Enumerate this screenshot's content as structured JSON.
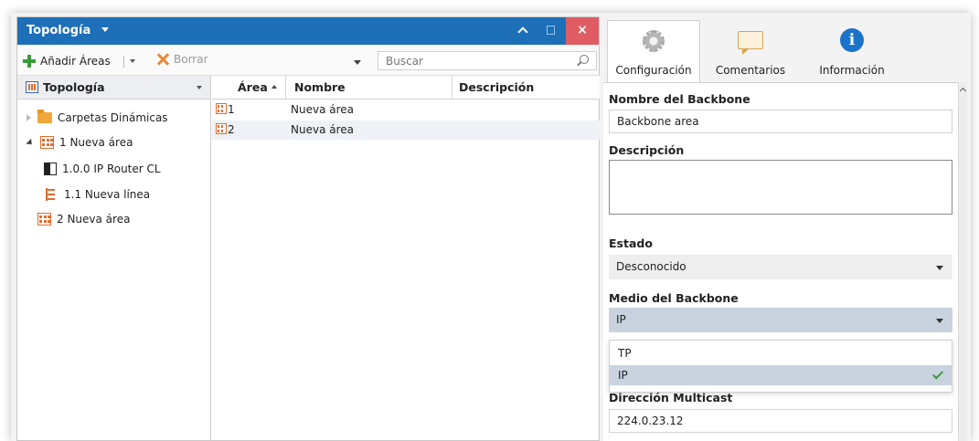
{
  "window": {
    "title": "Topología",
    "buttons": {
      "close": "×"
    }
  },
  "toolbar": {
    "add_label": "Añadir Áreas",
    "delete_label": "Borrar",
    "search_placeholder": "Buscar"
  },
  "tree": {
    "header": "Topología",
    "items": [
      {
        "label": "Carpetas Dinámicas",
        "icon": "folder-icon"
      },
      {
        "label": "1 Nueva área",
        "icon": "area-icon"
      },
      {
        "label": "1.0.0 IP Router CL",
        "icon": "router-icon"
      },
      {
        "label": "1.1 Nueva línea",
        "icon": "line-icon"
      },
      {
        "label": "2 Nueva área",
        "icon": "area-icon"
      }
    ]
  },
  "grid": {
    "columns": [
      "Área",
      "Nombre",
      "Descripción"
    ],
    "rows": [
      {
        "area": "1",
        "nombre": "Nueva área",
        "descripcion": ""
      },
      {
        "area": "2",
        "nombre": "Nueva área",
        "descripcion": ""
      }
    ]
  },
  "panel": {
    "tabs": [
      {
        "label": "Configuración",
        "icon": "gear-icon"
      },
      {
        "label": "Comentarios",
        "icon": "comment-icon"
      },
      {
        "label": "Información",
        "icon": "info-icon",
        "glyph": "i"
      }
    ],
    "fields": {
      "backbone_name_label": "Nombre del Backbone",
      "backbone_name_value": "Backbone area",
      "description_label": "Descripción",
      "description_value": "",
      "state_label": "Estado",
      "state_value": "Desconocido",
      "medium_label": "Medio del Backbone",
      "medium_value": "IP",
      "medium_options": [
        "TP",
        "IP"
      ],
      "multicast_label": "Dirección Multicast",
      "multicast_value": "224.0.23.12"
    }
  },
  "colors": {
    "titlebar": "#1d6fb8",
    "close": "#e05c63",
    "accent_orange": "#e46b2c",
    "selected": "#c9d3df"
  }
}
